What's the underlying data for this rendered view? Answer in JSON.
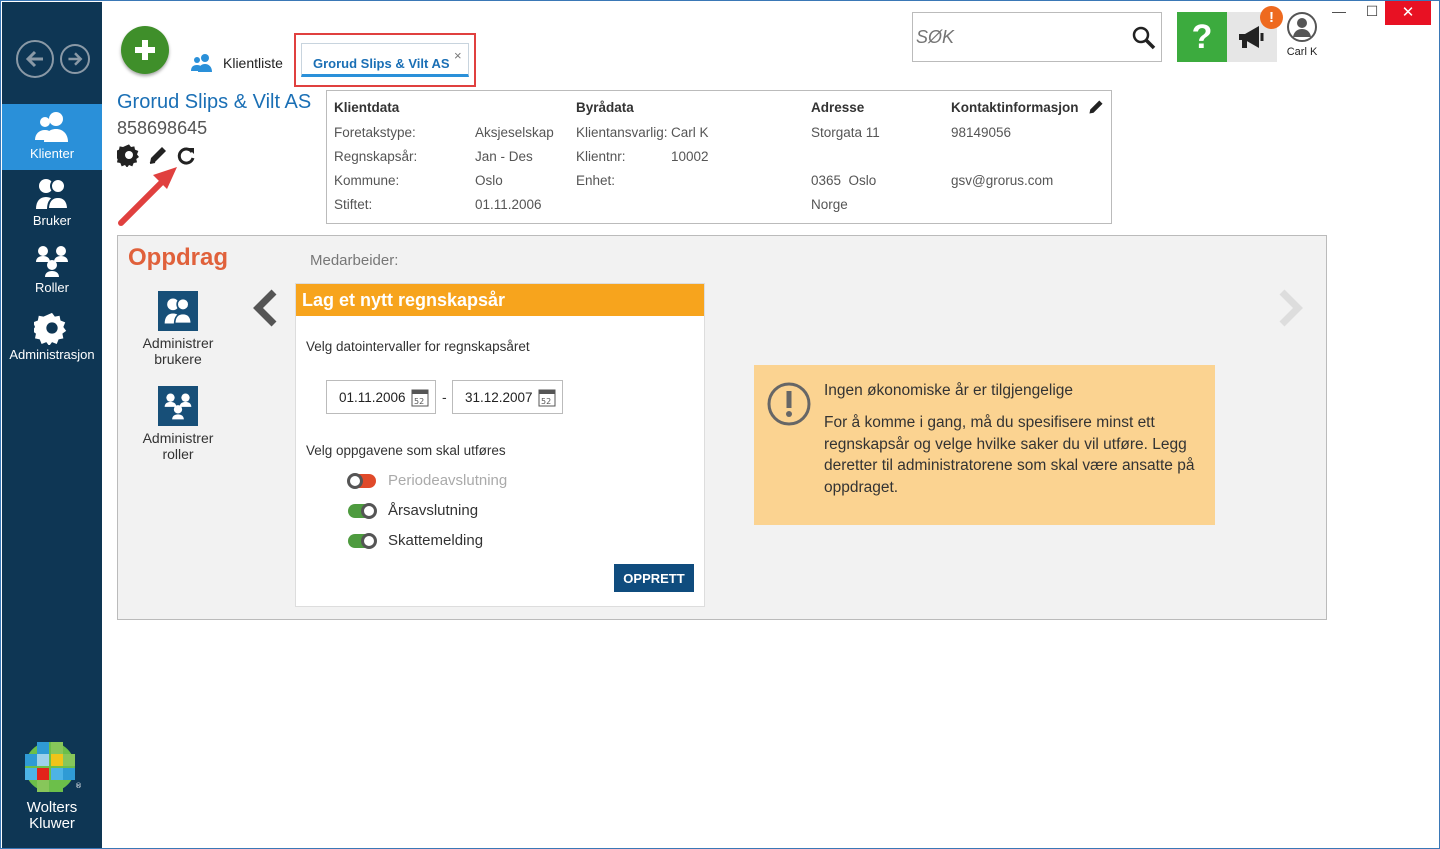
{
  "window": {
    "minimize": "—",
    "maximize": "☐",
    "close": "✕"
  },
  "sidebar": {
    "items": [
      {
        "label": "Klienter",
        "icon": "clients-icon",
        "active": true
      },
      {
        "label": "Bruker",
        "icon": "users-icon"
      },
      {
        "label": "Roller",
        "icon": "roles-icon"
      },
      {
        "label": "Administrasjon",
        "icon": "gear-icon"
      }
    ],
    "logo_line1": "Wolters",
    "logo_line2": "Kluwer"
  },
  "tabs": {
    "klientliste": "Klientliste",
    "active": "Grorud Slips & Vilt AS",
    "close": "×"
  },
  "search": {
    "placeholder": "SØK"
  },
  "help": "?",
  "badge": "!",
  "user": "Carl K",
  "client": {
    "name": "Grorud Slips & Vilt AS",
    "orgnr": "858698645"
  },
  "infobox": {
    "klientdata": {
      "heading": "Klientdata",
      "rows": [
        {
          "label": "Foretakstype:",
          "value": "Aksjeselskap"
        },
        {
          "label": "Regnskapsår:",
          "value": "Jan - Des"
        },
        {
          "label": "Kommune:",
          "value": "Oslo"
        },
        {
          "label": "Stiftet:",
          "value": "01.11.2006"
        }
      ]
    },
    "byradata": {
      "heading": "Byrådata",
      "ansvarlig_label": "Klientansvarlig:",
      "ansvarlig_value": "Carl K",
      "klientnr_label": "Klientnr:",
      "klientnr_value": "10002",
      "enhet_label": "Enhet:"
    },
    "adresse": {
      "heading": "Adresse",
      "street": "Storgata 11",
      "postal": "0365  Oslo",
      "country": "Norge"
    },
    "kontakt": {
      "heading": "Kontaktinformasjon",
      "phone": "98149056",
      "email": "gsv@grorus.com"
    }
  },
  "oppdrag": {
    "title": "Oppdrag",
    "medarbeider": "Medarbeider:",
    "tiles": [
      {
        "line1": "Administrer",
        "line2": "brukere"
      },
      {
        "line1": "Administrer",
        "line2": "roller"
      }
    ],
    "card": {
      "title": "Lag et nytt regnskapsår",
      "date_label": "Velg datointervaller for regnskapsåret",
      "from": "01.11.2006",
      "to": "31.12.2007",
      "sep": "-",
      "cal_day": "52",
      "tasks_label": "Velg oppgavene som skal utføres",
      "tasks": [
        {
          "label": "Periodeavslutning",
          "enabled": false
        },
        {
          "label": "Årsavslutning",
          "enabled": true
        },
        {
          "label": "Skattemelding",
          "enabled": true
        }
      ],
      "button": "OPPRETT"
    },
    "warning": {
      "title": "Ingen økonomiske år er tilgjengelige",
      "body": "For å komme i gang, må du spesifisere minst ett regnskapsår og velge hvilke saker du vil utføre. Legg deretter til administratorene som skal være ansatte på oppdraget."
    }
  },
  "colors": {
    "sidebar": "#0e3654",
    "active": "#2a90d9",
    "accent": "#f7a41d",
    "oppdrag": "#e0613b",
    "warning": "#fbd391"
  }
}
